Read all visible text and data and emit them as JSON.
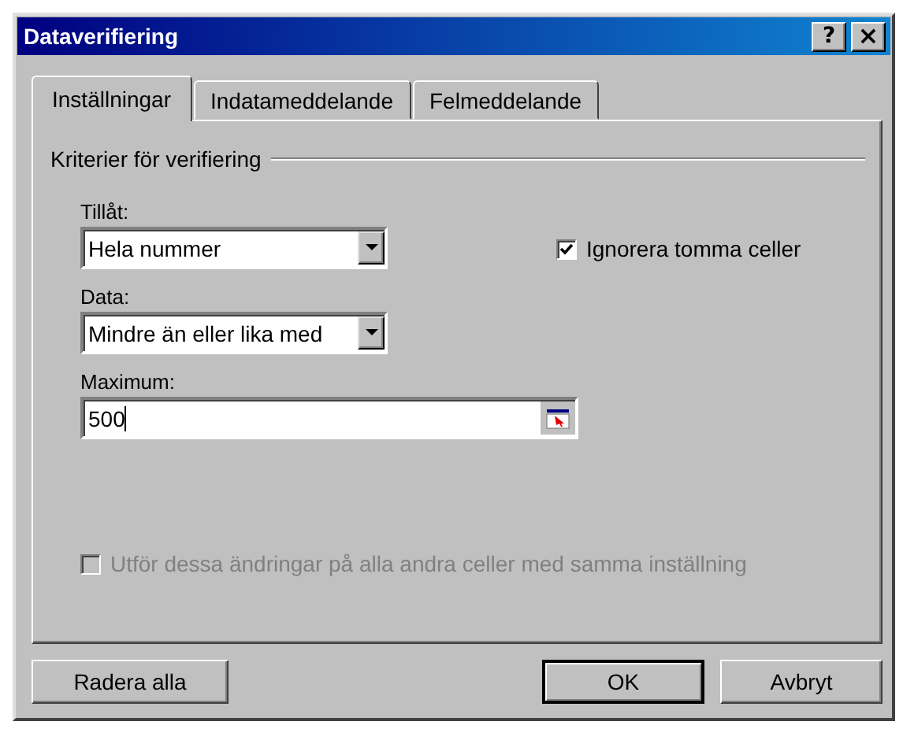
{
  "window": {
    "title": "Dataverifiering",
    "caption_buttons": [
      {
        "kind": "help",
        "label": "?"
      },
      {
        "kind": "close",
        "label": "×"
      }
    ]
  },
  "tabs": [
    {
      "label": "Inställningar",
      "selected": true
    },
    {
      "label": "Indatameddelande",
      "selected": false
    },
    {
      "label": "Felmeddelande",
      "selected": false
    }
  ],
  "group_label": "Kriterier för verifiering",
  "fields": [
    {
      "kind": "dropdown",
      "label": "Tillåt:",
      "value": "Hela nummer"
    },
    {
      "kind": "dropdown",
      "label": "Data:",
      "value": "Mindre än eller lika med"
    },
    {
      "kind": "range",
      "label": "Maximum:",
      "value": "500"
    }
  ],
  "ignore_blank": {
    "label": "Ignorera tomma celler",
    "checked": true,
    "disabled": false
  },
  "apply_all": {
    "label": "Utför dessa ändringar på alla andra celler med samma inställning",
    "checked": false,
    "disabled": true
  },
  "buttons": [
    {
      "label": "Radera alla",
      "default": false
    },
    {
      "label": "OK",
      "default": true
    },
    {
      "label": "Avbryt",
      "default": false
    }
  ]
}
